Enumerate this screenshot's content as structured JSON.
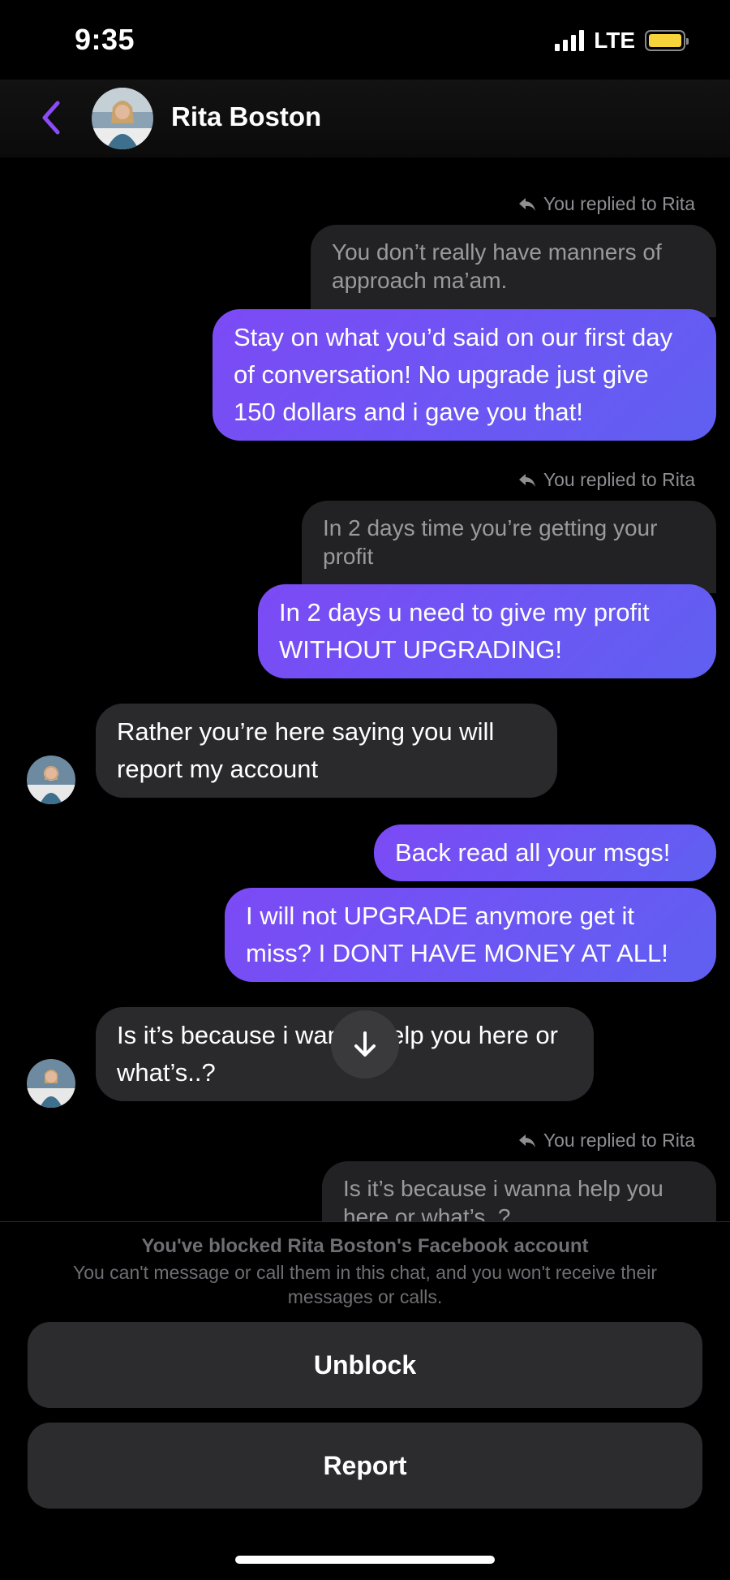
{
  "status_bar": {
    "time": "9:35",
    "network": "LTE",
    "battery_color": "#f6d23b"
  },
  "header": {
    "back_icon": "chevron-left-icon",
    "contact_name": "Rita Boston",
    "accent_color": "#8a4cf6"
  },
  "messages": [
    {
      "type": "reply_meta",
      "text": "You replied to Rita"
    },
    {
      "type": "quote",
      "text": "You don’t really have manners of approach ma’am."
    },
    {
      "type": "outgoing",
      "text": "Stay on what you’d said on our first day of conversation! No upgrade just give 150 dollars and i gave you that!"
    },
    {
      "type": "reply_meta",
      "text": "You replied to Rita"
    },
    {
      "type": "quote",
      "text": "In 2 days time you’re getting your profit"
    },
    {
      "type": "outgoing",
      "text": "In 2 days u need to give my profit WITHOUT UPGRADING!"
    },
    {
      "type": "incoming",
      "text": "Rather you’re here saying you will report my account"
    },
    {
      "type": "outgoing",
      "text": "Back read all your msgs!"
    },
    {
      "type": "outgoing",
      "text": "I will not UPGRADE anymore get it miss? I DONT HAVE MONEY AT ALL!"
    },
    {
      "type": "incoming",
      "text": "Is it’s because i wanna help you here or what’s..?"
    },
    {
      "type": "reply_meta",
      "text": "You replied to Rita"
    },
    {
      "type": "quote",
      "text": "Is it’s because i wanna help you here or what’s..?"
    }
  ],
  "scroll_button_icon": "arrow-down-icon",
  "blocked": {
    "title": "You've blocked Rita Boston's Facebook account",
    "description": "You can't message or call them in this chat, and you won't receive their messages or calls.",
    "unblock_label": "Unblock",
    "report_label": "Report"
  }
}
